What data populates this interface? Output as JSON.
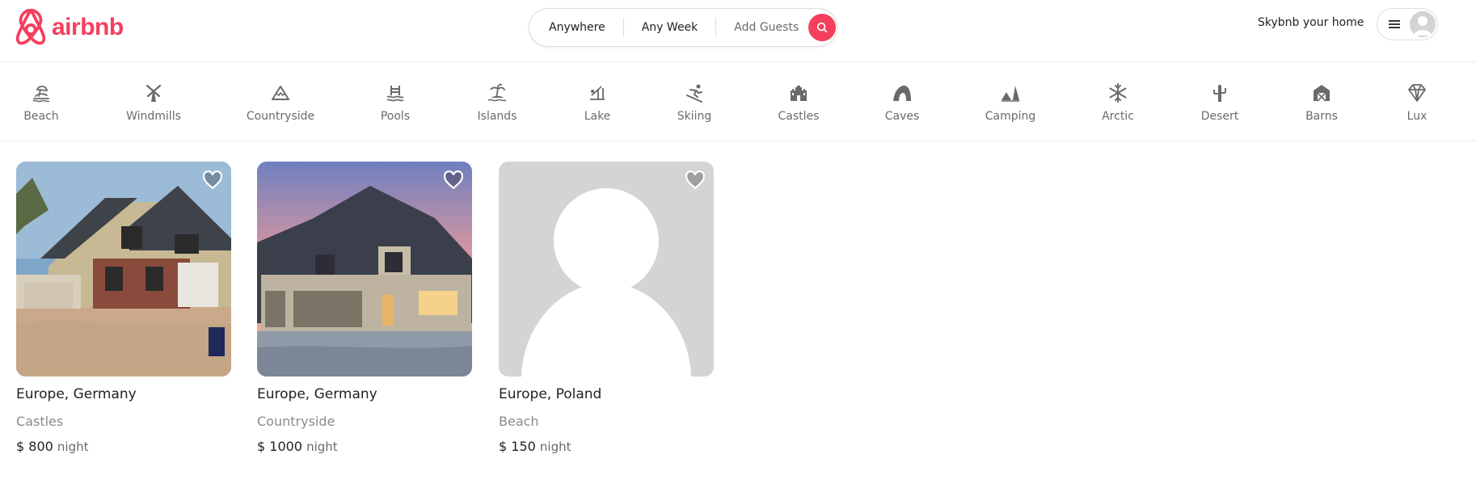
{
  "header": {
    "logo_text": "airbnb",
    "search": {
      "location": "Anywhere",
      "week": "Any Week",
      "guests": "Add Guests"
    },
    "host_link": "Skybnb your home"
  },
  "categories": [
    {
      "label": "Beach",
      "icon": "beach-icon"
    },
    {
      "label": "Windmills",
      "icon": "windmill-icon"
    },
    {
      "label": "Countryside",
      "icon": "mountain-icon"
    },
    {
      "label": "Pools",
      "icon": "pool-icon"
    },
    {
      "label": "Islands",
      "icon": "island-icon"
    },
    {
      "label": "Lake",
      "icon": "lake-icon"
    },
    {
      "label": "Skiing",
      "icon": "skiing-icon"
    },
    {
      "label": "Castles",
      "icon": "castle-icon"
    },
    {
      "label": "Caves",
      "icon": "cave-icon"
    },
    {
      "label": "Camping",
      "icon": "camping-icon"
    },
    {
      "label": "Arctic",
      "icon": "snowflake-icon"
    },
    {
      "label": "Desert",
      "icon": "cactus-icon"
    },
    {
      "label": "Barns",
      "icon": "barn-icon"
    },
    {
      "label": "Lux",
      "icon": "diamond-icon"
    }
  ],
  "listings": [
    {
      "location": "Europe, Germany",
      "category": "Castles",
      "price": "$ 800",
      "unit": "night"
    },
    {
      "location": "Europe, Germany",
      "category": "Countryside",
      "price": "$ 1000",
      "unit": "night"
    },
    {
      "location": "Europe, Poland",
      "category": "Beach",
      "price": "$ 150",
      "unit": "night"
    }
  ],
  "colors": {
    "brand": "#f43f5e",
    "text": "#222222",
    "muted": "#6a6a6a",
    "border": "#dddddd"
  }
}
